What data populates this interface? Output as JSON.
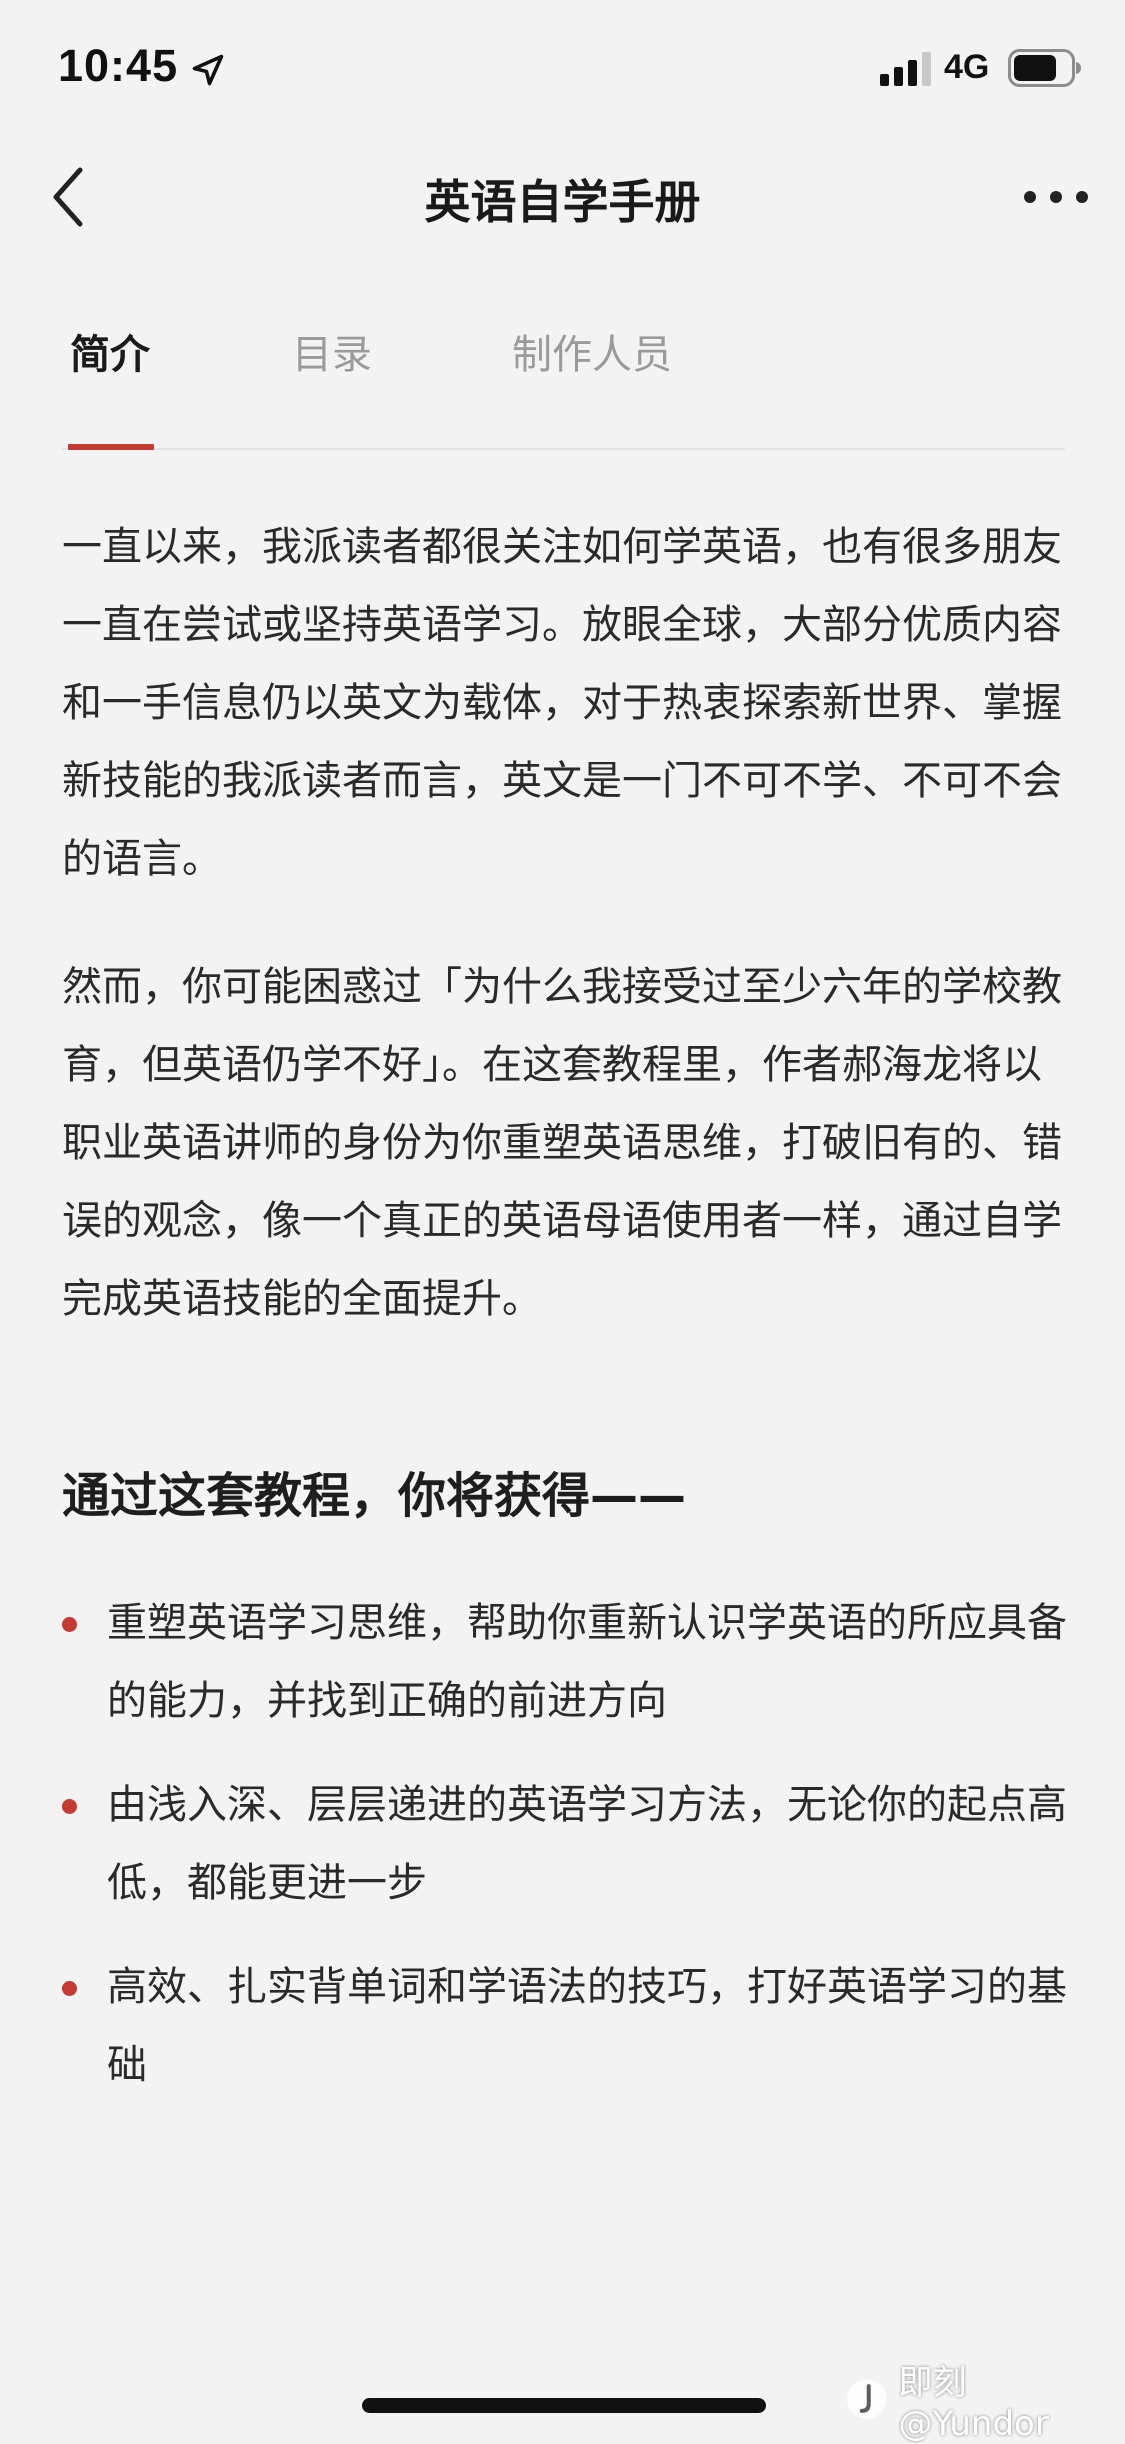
{
  "status_bar": {
    "time": "10:45",
    "network": "4G",
    "battery_level": 0.75,
    "signal_bars": 3
  },
  "nav": {
    "title": "英语自学手册"
  },
  "tabs": [
    {
      "label": "简介",
      "active": true
    },
    {
      "label": "目录",
      "active": false
    },
    {
      "label": "制作人员",
      "active": false
    }
  ],
  "intro": {
    "paragraphs": [
      "一直以来，我派读者都很关注如何学英语，也有很多朋友一直在尝试或坚持英语学习。放眼全球，大部分优质内容和一手信息仍以英文为载体，对于热衷探索新世界、掌握新技能的我派读者而言，英文是一门不可不学、不可不会的语言。",
      "然而，你可能困惑过「为什么我接受过至少六年的学校教育，但英语仍学不好」。在这套教程里，作者郝海龙将以职业英语讲师的身份为你重塑英语思维，打破旧有的、错误的观念，像一个真正的英语母语使用者一样，通过自学完成英语技能的全面提升。"
    ],
    "section_heading": "通过这套教程，你将获得——",
    "bullets": [
      "重塑英语学习思维，帮助你重新认识学英语的所应具备的能力，并找到正确的前进方向",
      "由浅入深、层层递进的英语学习方法，无论你的起点高低，都能更进一步",
      "高效、扎实背单词和学语法的技巧，打好英语学习的基础"
    ]
  },
  "watermark": {
    "text": "即刻 @Yundor"
  },
  "colors": {
    "accent": "#c63a34",
    "background": "#f3f3f3",
    "text": "#2a2a2a"
  }
}
